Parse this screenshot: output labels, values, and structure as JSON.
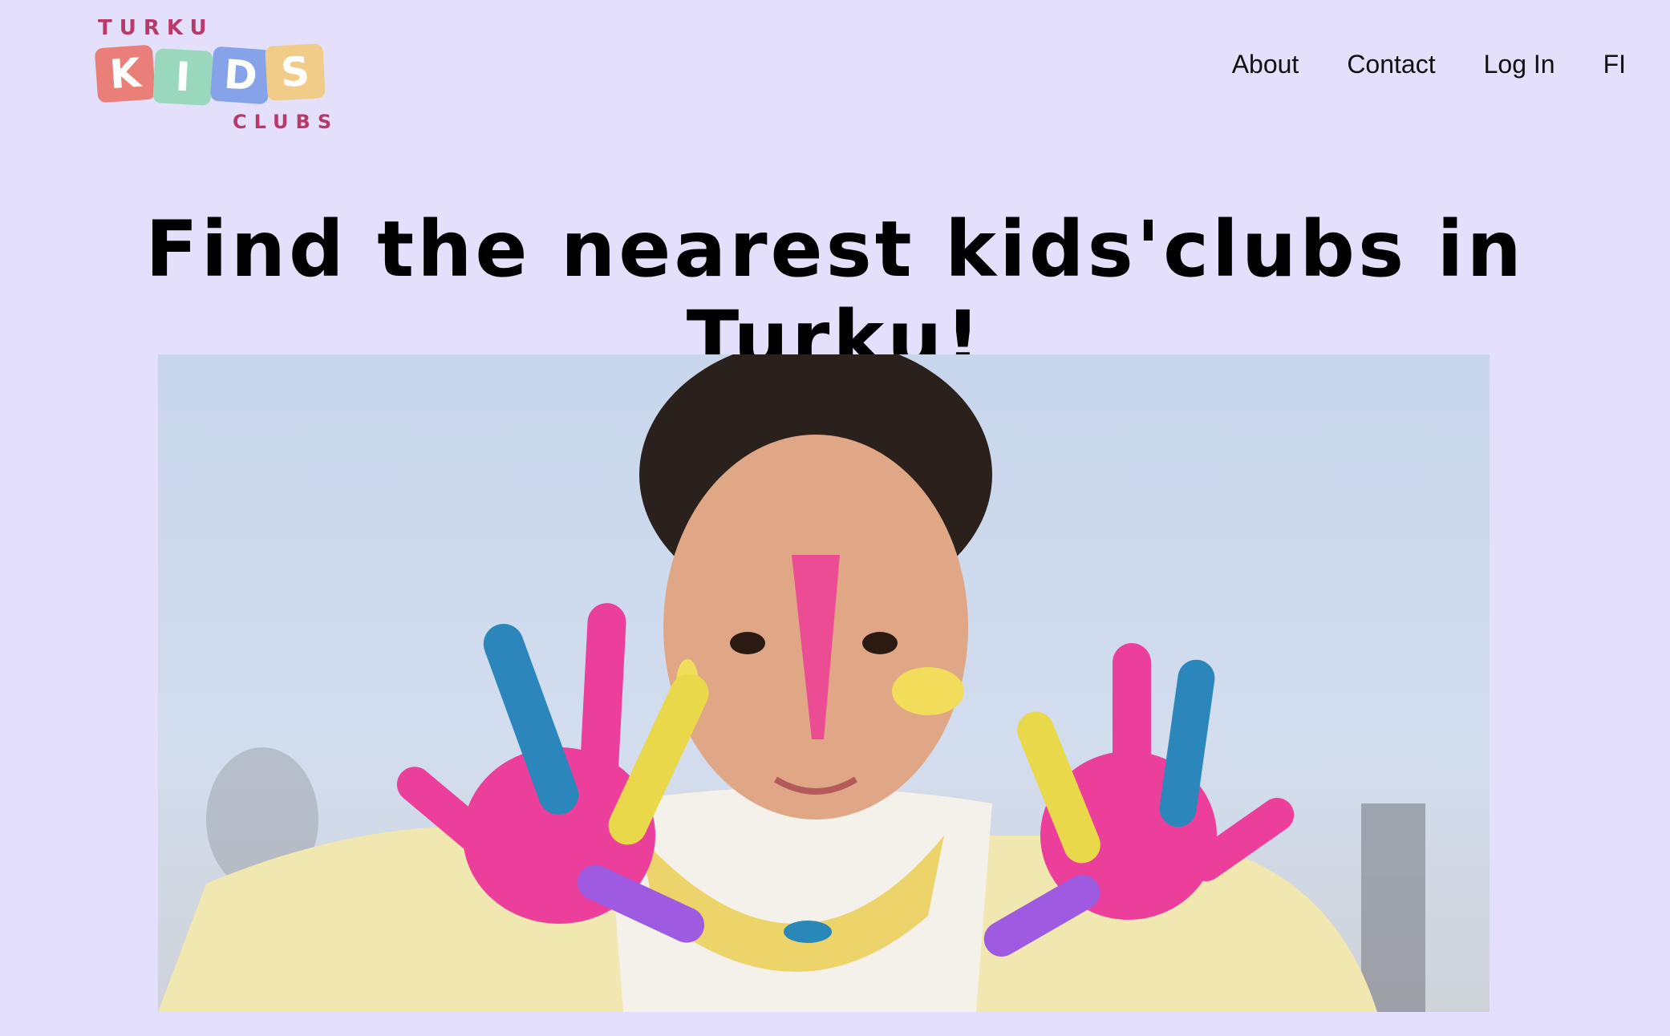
{
  "logo": {
    "top_text": "TURKU",
    "letters": [
      "K",
      "I",
      "D",
      "S"
    ],
    "bottom_text": "CLUBS",
    "tile_colors": [
      "#e97f78",
      "#9ad8be",
      "#86a3ea",
      "#f0cc88"
    ]
  },
  "nav": {
    "items": [
      {
        "label": "About"
      },
      {
        "label": "Contact"
      },
      {
        "label": "Log In"
      },
      {
        "label": "FI"
      }
    ]
  },
  "hero": {
    "heading": "Find the nearest kids'clubs in Turku!",
    "image": "child-with-painted-hands-photo"
  },
  "colors": {
    "background": "#e4e0fb",
    "logo_text": "#b83a6b"
  }
}
